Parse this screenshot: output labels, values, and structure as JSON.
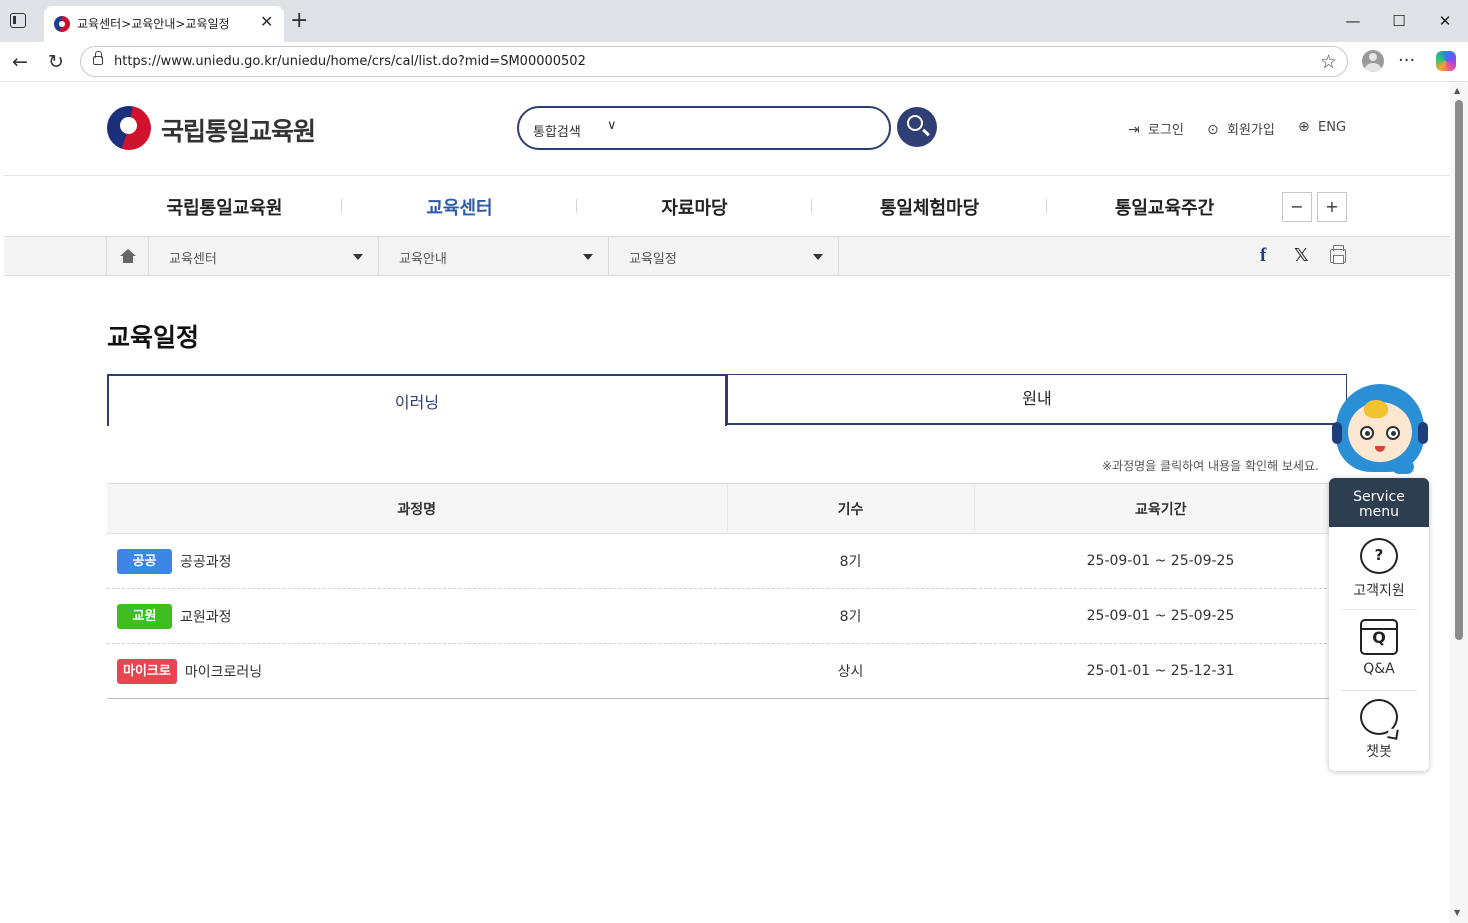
{
  "browser": {
    "tab_title": "교육센터>교육안내>교육일정",
    "url": "https://www.uniedu.go.kr/uniedu/home/crs/cal/list.do?mid=SM00000502",
    "new_tab": "+",
    "minimize": "—",
    "maximize": "☐",
    "close": "✕",
    "back": "←",
    "reload": "↻",
    "star": "☆",
    "more": "···",
    "tab_close": "✕"
  },
  "header": {
    "logo_text": "국립통일교육원",
    "search_scope": "통합검색",
    "search_chevron": "∨",
    "login": "로그인",
    "signup": "회원가입",
    "lang": "ENG"
  },
  "gnb": {
    "items": [
      {
        "label": "국립통일교육원"
      },
      {
        "label": "교육센터"
      },
      {
        "label": "자료마당"
      },
      {
        "label": "통일체험마당"
      },
      {
        "label": "통일교육주간"
      }
    ],
    "zoom_out": "−",
    "zoom_in": "+"
  },
  "location": {
    "items": [
      {
        "label": "교육센터"
      },
      {
        "label": "교육안내"
      },
      {
        "label": "교육일정"
      }
    ],
    "facebook": "f",
    "x": "𝕏"
  },
  "main": {
    "title": "교육일정",
    "tabs": [
      {
        "label": "이러닝",
        "active": true
      },
      {
        "label": "원내",
        "active": false
      }
    ],
    "notice": "※과정명을 클릭하여 내용을 확인해 보세요.",
    "table": {
      "headers": [
        "과정명",
        "기수",
        "교육기간"
      ],
      "rows": [
        {
          "badge": "공공",
          "badge_color": "#3d86e6",
          "course": "공공과정",
          "term": "8기",
          "period": "25-09-01 ~ 25-09-25"
        },
        {
          "badge": "교원",
          "badge_color": "#3fbf1f",
          "course": "교원과정",
          "term": "8기",
          "period": "25-09-01 ~ 25-09-25"
        },
        {
          "badge": "마이크로",
          "badge_color": "#e94550",
          "course": "마이크로러닝",
          "term": "상시",
          "period": "25-01-01 ~ 25-12-31"
        }
      ]
    }
  },
  "service_menu": {
    "title_line1": "Service",
    "title_line2": "menu",
    "items": [
      {
        "label": "고객지원",
        "icon": "headset-icon"
      },
      {
        "label": "Q&A",
        "icon": "qa-icon"
      },
      {
        "label": "챗봇",
        "icon": "chat-icon"
      }
    ]
  },
  "colors": {
    "brand_navy": "#2f3f75",
    "active_menu": "#2f5aa8",
    "service_header": "#2c3e50"
  }
}
